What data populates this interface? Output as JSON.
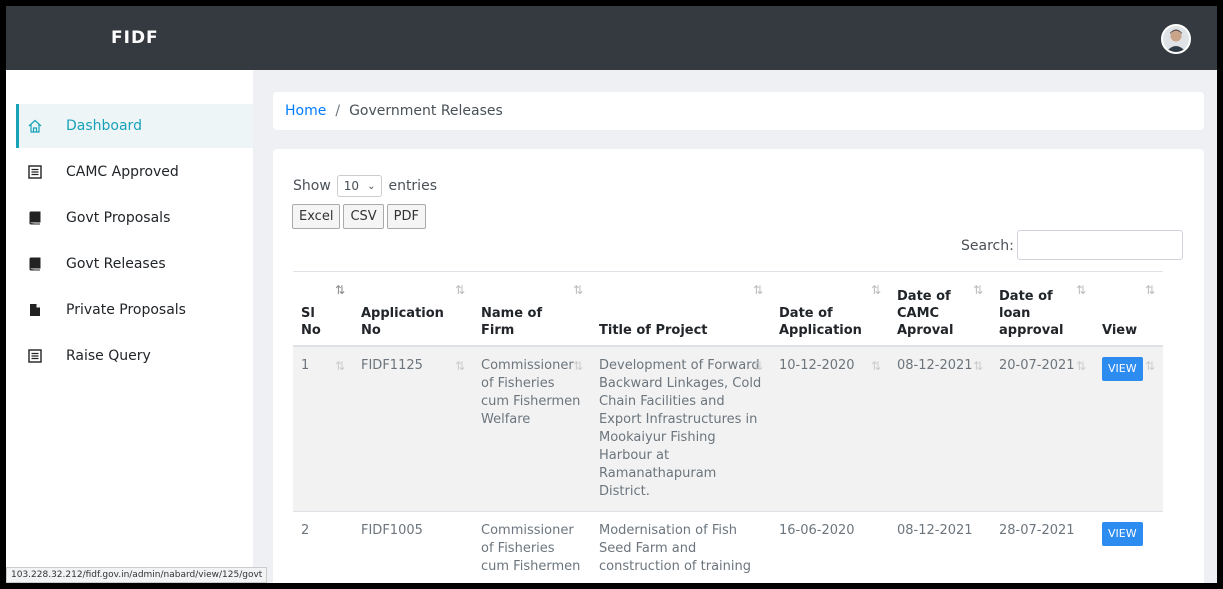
{
  "app": {
    "brand": "FIDF"
  },
  "sidebar": {
    "items": [
      {
        "label": "Dashboard",
        "icon": "home-icon",
        "active": true
      },
      {
        "label": "CAMC Approved",
        "icon": "list-icon"
      },
      {
        "label": "Govt Proposals",
        "icon": "book-icon"
      },
      {
        "label": "Govt Releases",
        "icon": "book-icon"
      },
      {
        "label": "Private Proposals",
        "icon": "file-icon"
      },
      {
        "label": "Raise Query",
        "icon": "list-icon"
      }
    ]
  },
  "status_url": "103.228.32.212/fidf.gov.in/admin/nabard/view/125/govt",
  "breadcrumb": {
    "home": "Home",
    "sep": "/",
    "current": "Government Releases"
  },
  "table_controls": {
    "show_label": "Show",
    "entries_value": "10",
    "entries_label": "entries",
    "export_buttons": [
      "Excel",
      "CSV",
      "PDF"
    ],
    "search_label": "Search:"
  },
  "table": {
    "headers": [
      "Sl No",
      "Application No",
      "Name of Firm",
      "Title of Project",
      "Date of Application",
      "Date of CAMC Aproval",
      "Date of loan approval",
      "View"
    ],
    "rows": [
      {
        "sl": "1",
        "app_no": "FIDF1125",
        "firm": "Commissioner of Fisheries cum Fishermen Welfare",
        "title": "Development of Forward Backward Linkages, Cold Chain Facilities and Export Infrastructures in Mookaiyur Fishing Harbour at Ramanathapuram District.",
        "date_app": "10-12-2020",
        "date_camc": "08-12-2021",
        "date_loan": "20-07-2021",
        "view": "VIEW"
      },
      {
        "sl": "2",
        "app_no": "FIDF1005",
        "firm": "Commissioner of Fisheries cum Fishermen",
        "title": "Modernisation of Fish Seed Farm and construction of training",
        "date_app": "16-06-2020",
        "date_camc": "08-12-2021",
        "date_loan": "28-07-2021",
        "view": "VIEW"
      }
    ]
  },
  "colors": {
    "topbar": "#343a40",
    "accent": "#17a2b8",
    "link": "#007bff",
    "view_button": "#2d8cf0"
  }
}
